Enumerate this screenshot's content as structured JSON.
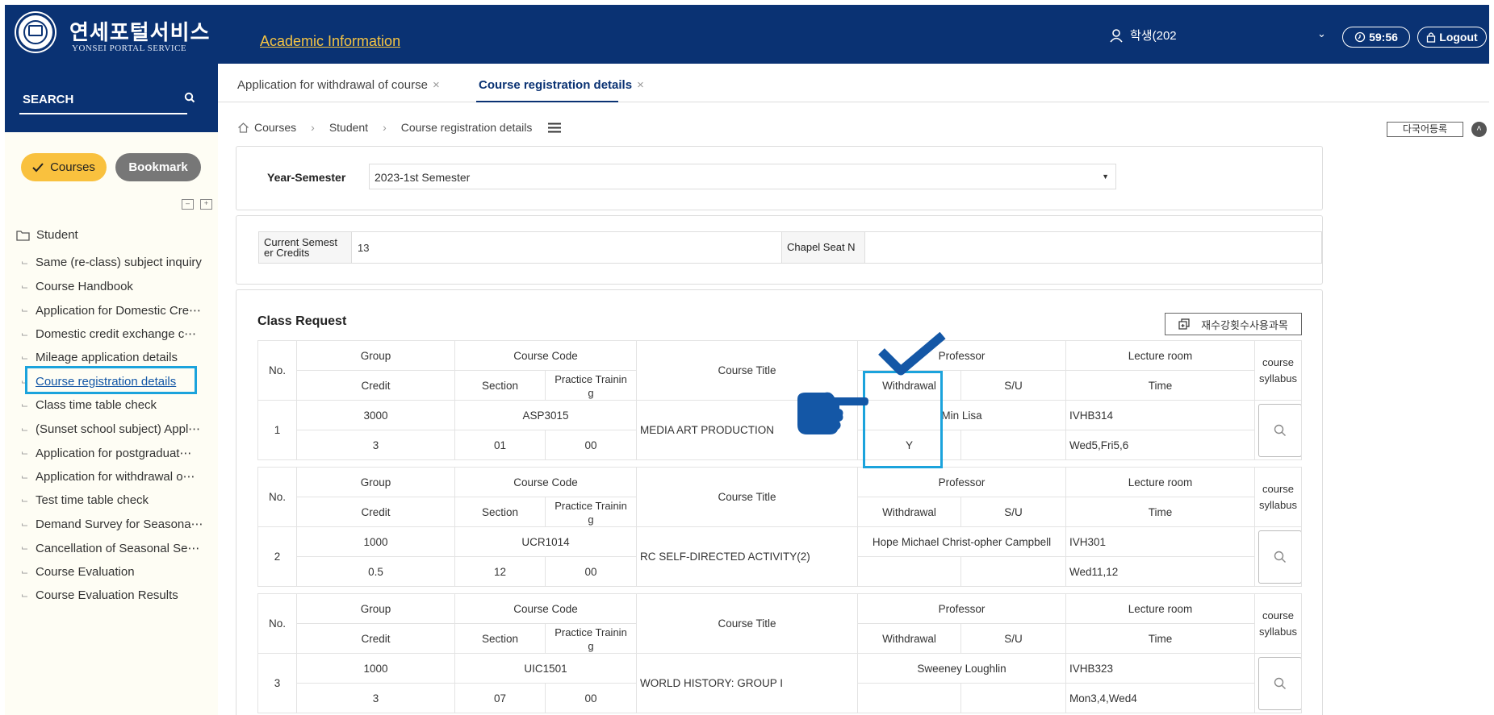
{
  "header": {
    "brand_ko": "연세포털서비스",
    "brand_en": "YONSEI PORTAL SERVICE",
    "section_link": "Academic Information",
    "user": "학생(202",
    "timer": "59:56",
    "logout": "Logout"
  },
  "sidebar": {
    "search_label": "SEARCH",
    "courses_btn": "Courses",
    "bookmark_btn": "Bookmark",
    "folder": "Student",
    "items": [
      {
        "label": "Same (re-class) subject inquiry"
      },
      {
        "label": "Course Handbook"
      },
      {
        "label": "Application for Domestic Cre⋯"
      },
      {
        "label": "Domestic credit exchange c⋯"
      },
      {
        "label": "Mileage application details"
      },
      {
        "label": "Course registration details"
      },
      {
        "label": "Class time table check"
      },
      {
        "label": "(Sunset school subject) Appl⋯"
      },
      {
        "label": "Application for postgraduat⋯"
      },
      {
        "label": "Application for withdrawal o⋯"
      },
      {
        "label": "Test time table check"
      },
      {
        "label": "Demand Survey for Seasona⋯"
      },
      {
        "label": "Cancellation of Seasonal Se⋯"
      },
      {
        "label": "Course Evaluation"
      },
      {
        "label": "Course Evaluation Results"
      }
    ]
  },
  "tabs": [
    {
      "label": "Application for withdrawal of course"
    },
    {
      "label": "Course registration details"
    }
  ],
  "breadcrumb": {
    "home": "Courses",
    "level1": "Student",
    "level2": "Course registration details"
  },
  "lang_btn": "다국어등록",
  "filter": {
    "label": "Year-Semester",
    "value": "2023-1st Semester"
  },
  "info": {
    "credits_label": "Current Semester Credits",
    "credits_label_l1": "Current Semest",
    "credits_label_l2": "er Credits",
    "credits_value": "13",
    "chapel_label": "Chapel Seat N",
    "chapel_value": ""
  },
  "class_request": {
    "title": "Class Request",
    "retake_btn": "재수강횟수사용과목",
    "headers": {
      "no": "No.",
      "group": "Group",
      "credit": "Credit",
      "course_code": "Course Code",
      "section": "Section",
      "practice": "Practice Trainin g",
      "practice_l1": "Practice Trainin",
      "practice_l2": "g",
      "course_title": "Course Title",
      "professor": "Professor",
      "withdrawal": "Withdrawal",
      "su": "S/U",
      "lecture_room": "Lecture room",
      "time": "Time",
      "syllabus_l1": "course",
      "syllabus_l2": "syllabus"
    },
    "rows": [
      {
        "no": "1",
        "group": "3000",
        "code": "ASP3015",
        "credit": "3",
        "section": "01",
        "practice": "00",
        "title": "MEDIA ART PRODUCTION",
        "professor": "Min Lisa",
        "withdrawal": "Y",
        "su": "",
        "room": "IVHB314",
        "time": "Wed5,Fri5,6"
      },
      {
        "no": "2",
        "group": "1000",
        "code": "UCR1014",
        "credit": "0.5",
        "section": "12",
        "practice": "00",
        "title": "RC SELF-DIRECTED ACTIVITY(2)",
        "professor": "Hope Michael Christ-opher Campbell",
        "withdrawal": "",
        "su": "",
        "room": "IVH301",
        "time": "Wed11,12"
      },
      {
        "no": "3",
        "group": "1000",
        "code": "UIC1501",
        "credit": "3",
        "section": "07",
        "practice": "00",
        "title": "WORLD HISTORY: GROUP I",
        "professor": "Sweeney Loughlin",
        "withdrawal": "",
        "su": "",
        "room": "IVHB323",
        "time": "Mon3,4,Wed4"
      }
    ]
  },
  "colors": {
    "navy": "#0a3273",
    "accent_yellow": "#f9c13e",
    "highlight_blue": "#1ba3dc",
    "annotation_blue": "#1457a6"
  }
}
